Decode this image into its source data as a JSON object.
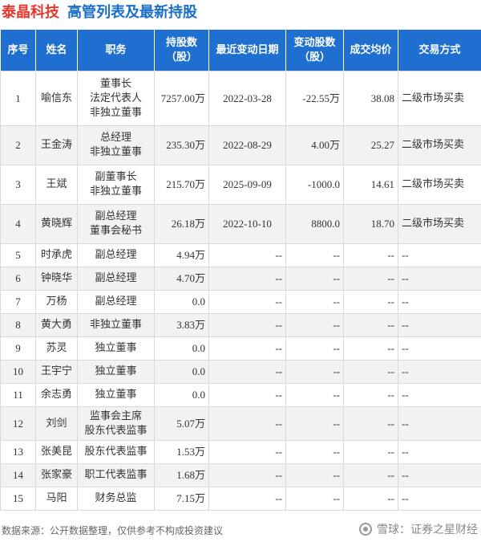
{
  "header": {
    "company": "泰晶科技",
    "subtitle": "高管列表及最新持股"
  },
  "table": {
    "columns": [
      "序号",
      "姓名",
      "职务",
      "持股数\n（股）",
      "最近变动日期",
      "变动股数\n（股）",
      "成交均价",
      "交易方式"
    ],
    "rows": [
      {
        "idx": "1",
        "name": "喻信东",
        "duty": [
          "董事长",
          "法定代表人",
          "非独立董事"
        ],
        "shares": "7257.00万",
        "date": "2022-03-28",
        "change": "-22.55万",
        "change_color": "neg",
        "price": "38.08",
        "price_color": "posg",
        "method": "二级市场买卖"
      },
      {
        "idx": "2",
        "name": "王金涛",
        "duty": [
          "总经理",
          "非独立董事"
        ],
        "shares": "235.30万",
        "date": "2022-08-29",
        "change": "4.00万",
        "change_color": "pos",
        "price": "25.27",
        "price_color": "pos",
        "method": "二级市场买卖"
      },
      {
        "idx": "3",
        "name": "王斌",
        "duty": [
          "副董事长",
          "非独立董事"
        ],
        "shares": "215.70万",
        "date": "2025-09-09",
        "change": "-1000.0",
        "change_color": "neg",
        "price": "14.61",
        "price_color": "posg",
        "method": "二级市场买卖"
      },
      {
        "idx": "4",
        "name": "黄晓辉",
        "duty": [
          "副总经理",
          "董事会秘书"
        ],
        "shares": "26.18万",
        "date": "2022-10-10",
        "change": "8800.0",
        "change_color": "pos",
        "price": "18.70",
        "price_color": "pos",
        "method": "二级市场买卖"
      },
      {
        "idx": "5",
        "name": "时承虎",
        "duty": [
          "副总经理"
        ],
        "shares": "4.94万",
        "date": "--",
        "change": "--",
        "change_color": "",
        "price": "--",
        "price_color": "",
        "method": "--"
      },
      {
        "idx": "6",
        "name": "钟晓华",
        "duty": [
          "副总经理"
        ],
        "shares": "4.70万",
        "date": "--",
        "change": "--",
        "change_color": "",
        "price": "--",
        "price_color": "",
        "method": "--"
      },
      {
        "idx": "7",
        "name": "万杨",
        "duty": [
          "副总经理"
        ],
        "shares": "0.0",
        "date": "--",
        "change": "--",
        "change_color": "",
        "price": "--",
        "price_color": "",
        "method": "--"
      },
      {
        "idx": "8",
        "name": "黄大勇",
        "duty": [
          "非独立董事"
        ],
        "shares": "3.83万",
        "date": "--",
        "change": "--",
        "change_color": "",
        "price": "--",
        "price_color": "",
        "method": "--"
      },
      {
        "idx": "9",
        "name": "苏灵",
        "duty": [
          "独立董事"
        ],
        "shares": "0.0",
        "date": "--",
        "change": "--",
        "change_color": "",
        "price": "--",
        "price_color": "",
        "method": "--"
      },
      {
        "idx": "10",
        "name": "王宇宁",
        "duty": [
          "独立董事"
        ],
        "shares": "0.0",
        "date": "--",
        "change": "--",
        "change_color": "",
        "price": "--",
        "price_color": "",
        "method": "--"
      },
      {
        "idx": "11",
        "name": "余志勇",
        "duty": [
          "独立董事"
        ],
        "shares": "0.0",
        "date": "--",
        "change": "--",
        "change_color": "",
        "price": "--",
        "price_color": "",
        "method": "--"
      },
      {
        "idx": "12",
        "name": "刘剑",
        "duty": [
          "监事会主席",
          "股东代表监事"
        ],
        "shares": "5.07万",
        "date": "--",
        "change": "--",
        "change_color": "",
        "price": "--",
        "price_color": "",
        "method": "--"
      },
      {
        "idx": "13",
        "name": "张美昆",
        "duty": [
          "股东代表监事"
        ],
        "shares": "1.53万",
        "date": "--",
        "change": "--",
        "change_color": "",
        "price": "--",
        "price_color": "",
        "method": "--"
      },
      {
        "idx": "14",
        "name": "张家豪",
        "duty": [
          "职工代表监事"
        ],
        "shares": "1.68万",
        "date": "--",
        "change": "--",
        "change_color": "",
        "price": "--",
        "price_color": "",
        "method": "--"
      },
      {
        "idx": "15",
        "name": "马阳",
        "duty": [
          "财务总监"
        ],
        "shares": "7.15万",
        "date": "--",
        "change": "--",
        "change_color": "",
        "price": "--",
        "price_color": "",
        "method": "--"
      }
    ]
  },
  "footer": {
    "source": "数据来源：公开数据整理，仅供参考不构成投资建议",
    "brand": "雪球：证券之星财经"
  },
  "colors": {
    "header_bg": "#1e6fd0",
    "company": "#e6392c",
    "subtitle": "#1b6fcc",
    "negative": "#1f9a3c",
    "positive": "#e02020"
  }
}
